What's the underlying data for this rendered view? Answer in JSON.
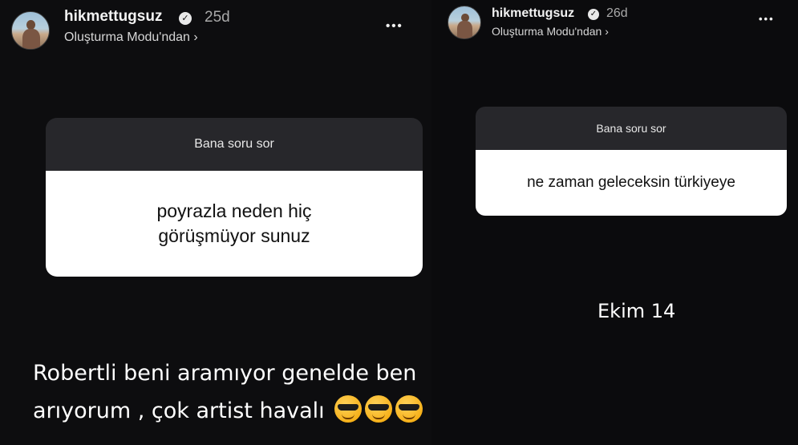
{
  "left_story": {
    "username": "hikmettugsuz",
    "age": "25d",
    "subtitle": "Oluşturma Modu'ndan ›",
    "question_title": "Bana soru sor",
    "question_line1": "poyrazla neden hiç",
    "question_line2": "görüşmüyor sunuz",
    "caption_line1": "Robertli beni aramıyor genelde ben",
    "caption_line2": "arıyorum , çok artist havalı"
  },
  "right_story": {
    "username": "hikmettugsuz",
    "age": "26d",
    "subtitle": "Oluşturma Modu'ndan ›",
    "question_title": "Bana soru sor",
    "question_text": "ne zaman geleceksin türkiyeye",
    "date_text": "Ekim 14"
  },
  "common": {
    "more_glyph": "•••",
    "verified_glyph": "✓"
  }
}
